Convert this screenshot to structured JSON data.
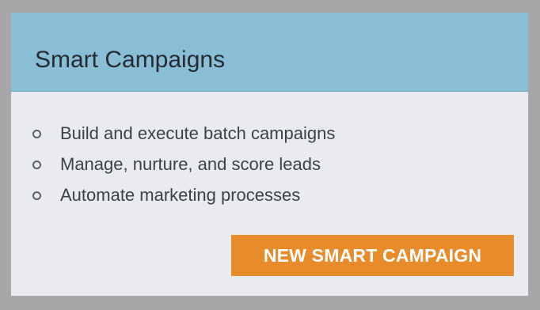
{
  "card": {
    "title": "Smart Campaigns",
    "features": [
      "Build and execute batch campaigns",
      "Manage, nurture, and score leads",
      "Automate marketing processes"
    ],
    "button_label": "NEW SMART CAMPAIGN"
  },
  "icons": {
    "bullet": "hollow-circle"
  },
  "colors": {
    "background": "#a7a7a9",
    "header": "#89bed6",
    "card_body": "#e9ebef",
    "button": "#e88b2a"
  }
}
